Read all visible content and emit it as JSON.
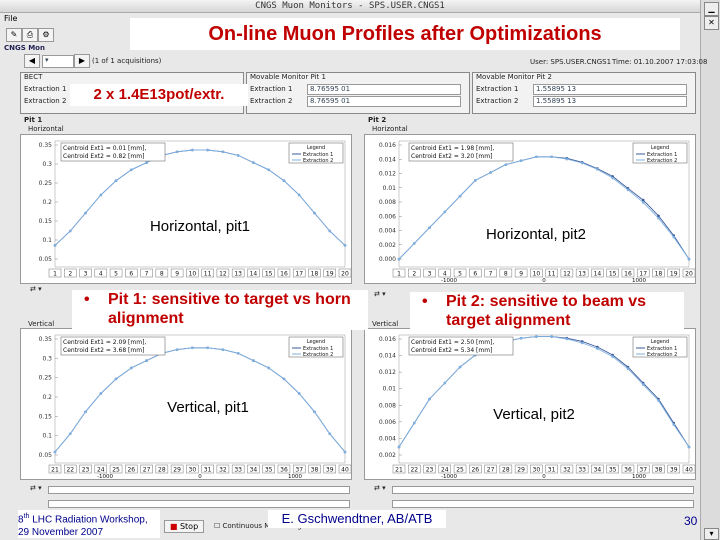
{
  "window": {
    "title": "CNGS Muon Monitors - SPS.USER.CNGS1",
    "menu": "File",
    "tab": "CNGS Mon",
    "acq_label": "(1 of 1 acquisitions)"
  },
  "slide": {
    "title": "On-line Muon Profiles after Optimizations",
    "intensity": "2 x 1.4E13pot/extr.",
    "label_h1": "Horizontal, pit1",
    "label_h2": "Horizontal, pit2",
    "label_v1": "Vertical, pit1",
    "label_v2": "Vertical, pit2",
    "bullet_left": "Pit 1: sensitive to target vs horn alignment",
    "bullet_right": "Pit 2: sensitive to  beam vs target alignment",
    "bullet_glyph": "•",
    "footer_workshop_sup": "th",
    "footer_workshop_num": "8",
    "footer_workshop": "LHC Radiation Workshop,",
    "footer_date": "29 November 2007",
    "footer_author": "E. Gschwendtner, AB/ATB",
    "page_number": "30"
  },
  "header_panels": {
    "beam_title": "BECT",
    "beam_rows": [
      "Extraction 1",
      "Extraction 2"
    ],
    "muon1_title": "Movable Monitor Pit 1",
    "muon1_rows": [
      "Extraction 1",
      "Extraction 2"
    ],
    "muon1_vals": [
      "8.76595 01",
      "8.76595 01"
    ],
    "muon2_title": "Movable Monitor Pit 2",
    "muon2_rows": [
      "Extraction 1",
      "Extraction 2"
    ],
    "muon2_vals": [
      "1.55895 13",
      "1.55895 13"
    ],
    "user": "User: SPS.USER.CNGS1",
    "time": "Time: 01.10.2007 17:03:08"
  },
  "plots": {
    "pit1_label": "Pit 1",
    "pit2_label": "Pit 2",
    "horizontal_tab": "Horizontal",
    "vertical_tab": "Vertical",
    "legend_title": "Legend",
    "legend_ext1": "Extraction 1",
    "legend_ext2": "Extraction 2",
    "h1_centroid1": "Centroid Ext1 = 0.01 [mm],",
    "h1_centroid2": "Centroid Ext2 = 0.82 [mm]",
    "h2_centroid1": "Centroid Ext1 = 1.98 [mm],",
    "h2_centroid2": "Centroid Ext2 = 3.20 [mm]",
    "v1_centroid1": "Centroid Ext1 = 2.09 [mm],",
    "v1_centroid2": "Centroid Ext2 = 3.68 [mm]",
    "v2_centroid1": "Centroid Ext1 = 2.50 [mm],",
    "v2_centroid2": "Centroid Ext2 = 5.34 [mm]",
    "x_1000_neg": "-1000",
    "x_0": "0",
    "x_1000": "1000"
  },
  "bottom": {
    "stop_label": "Stop",
    "status": "Continuous Monitoring"
  },
  "chart_data": [
    {
      "type": "line",
      "name_label": "Horizontal, pit1",
      "y_ticks": [
        "0.35",
        "0.3",
        "0.25",
        "0.2",
        "0.15",
        "0.1",
        "0.05"
      ],
      "x_ticks": [
        "1",
        "2",
        "3",
        "4",
        "5",
        "6",
        "7",
        "8",
        "9",
        "10",
        "11",
        "12",
        "13",
        "14",
        "15",
        "16",
        "17",
        "18",
        "19",
        "20"
      ],
      "series": [
        {
          "values": [
            0.06,
            0.1,
            0.15,
            0.2,
            0.24,
            0.27,
            0.29,
            0.31,
            0.32,
            0.325,
            0.325,
            0.32,
            0.31,
            0.29,
            0.27,
            0.24,
            0.2,
            0.15,
            0.1,
            0.06
          ]
        },
        {
          "values": [
            0.06,
            0.1,
            0.15,
            0.2,
            0.24,
            0.27,
            0.29,
            0.31,
            0.32,
            0.325,
            0.325,
            0.32,
            0.31,
            0.29,
            0.27,
            0.24,
            0.2,
            0.15,
            0.1,
            0.06
          ]
        }
      ],
      "ylim": [
        0.0,
        0.35
      ]
    },
    {
      "type": "line",
      "name_label": "Horizontal, pit2",
      "y_ticks": [
        "0.016",
        "0.014",
        "0.012",
        "0.01",
        "0.008",
        "0.006",
        "0.004",
        "0.002",
        "0.000"
      ],
      "x_ticks": [
        "1",
        "2",
        "3",
        "4",
        "5",
        "6",
        "7",
        "8",
        "9",
        "10",
        "11",
        "12",
        "13",
        "14",
        "15",
        "16",
        "17",
        "18",
        "19",
        "20"
      ],
      "series": [
        {
          "values": [
            0.001,
            0.003,
            0.005,
            0.007,
            0.009,
            0.011,
            0.012,
            0.013,
            0.0135,
            0.014,
            0.014,
            0.0138,
            0.0133,
            0.0125,
            0.0115,
            0.01,
            0.0085,
            0.0065,
            0.004,
            0.001
          ]
        },
        {
          "values": [
            0.001,
            0.003,
            0.005,
            0.007,
            0.009,
            0.011,
            0.012,
            0.013,
            0.0135,
            0.014,
            0.014,
            0.0137,
            0.0132,
            0.0124,
            0.0113,
            0.0098,
            0.0082,
            0.0062,
            0.0038,
            0.001
          ]
        }
      ],
      "ylim": [
        0.0,
        0.016
      ]
    },
    {
      "type": "line",
      "name_label": "Vertical, pit1",
      "y_ticks": [
        "0.35",
        "0.3",
        "0.25",
        "0.2",
        "0.15",
        "0.1",
        "0.05"
      ],
      "x_ticks": [
        "21",
        "22",
        "23",
        "24",
        "25",
        "26",
        "27",
        "28",
        "29",
        "30",
        "31",
        "32",
        "33",
        "34",
        "35",
        "36",
        "37",
        "38",
        "39",
        "40"
      ],
      "series": [
        {
          "values": [
            0.03,
            0.08,
            0.14,
            0.19,
            0.23,
            0.26,
            0.28,
            0.3,
            0.31,
            0.315,
            0.315,
            0.31,
            0.3,
            0.28,
            0.26,
            0.23,
            0.19,
            0.14,
            0.08,
            0.03
          ]
        },
        {
          "values": [
            0.03,
            0.08,
            0.14,
            0.19,
            0.23,
            0.26,
            0.28,
            0.3,
            0.31,
            0.315,
            0.315,
            0.31,
            0.3,
            0.28,
            0.26,
            0.23,
            0.19,
            0.14,
            0.08,
            0.03
          ]
        }
      ],
      "ylim": [
        0.0,
        0.35
      ]
    },
    {
      "type": "line",
      "name_label": "Vertical, pit2",
      "y_ticks": [
        "0.016",
        "0.014",
        "0.012",
        "0.01",
        "0.008",
        "0.006",
        "0.004",
        "0.002"
      ],
      "x_ticks": [
        "21",
        "22",
        "23",
        "24",
        "25",
        "26",
        "27",
        "28",
        "29",
        "30",
        "31",
        "32",
        "33",
        "34",
        "35",
        "36",
        "37",
        "38",
        "39",
        "40"
      ],
      "series": [
        {
          "values": [
            0.002,
            0.005,
            0.008,
            0.01,
            0.012,
            0.0135,
            0.0145,
            0.0152,
            0.0156,
            0.0158,
            0.0158,
            0.0156,
            0.0152,
            0.0145,
            0.0135,
            0.012,
            0.01,
            0.008,
            0.005,
            0.002
          ]
        },
        {
          "values": [
            0.002,
            0.005,
            0.008,
            0.01,
            0.012,
            0.0135,
            0.0145,
            0.0152,
            0.0156,
            0.0158,
            0.0158,
            0.0155,
            0.015,
            0.0143,
            0.0133,
            0.0118,
            0.0098,
            0.0078,
            0.0048,
            0.002
          ]
        }
      ],
      "ylim": [
        0.0,
        0.016
      ]
    }
  ]
}
